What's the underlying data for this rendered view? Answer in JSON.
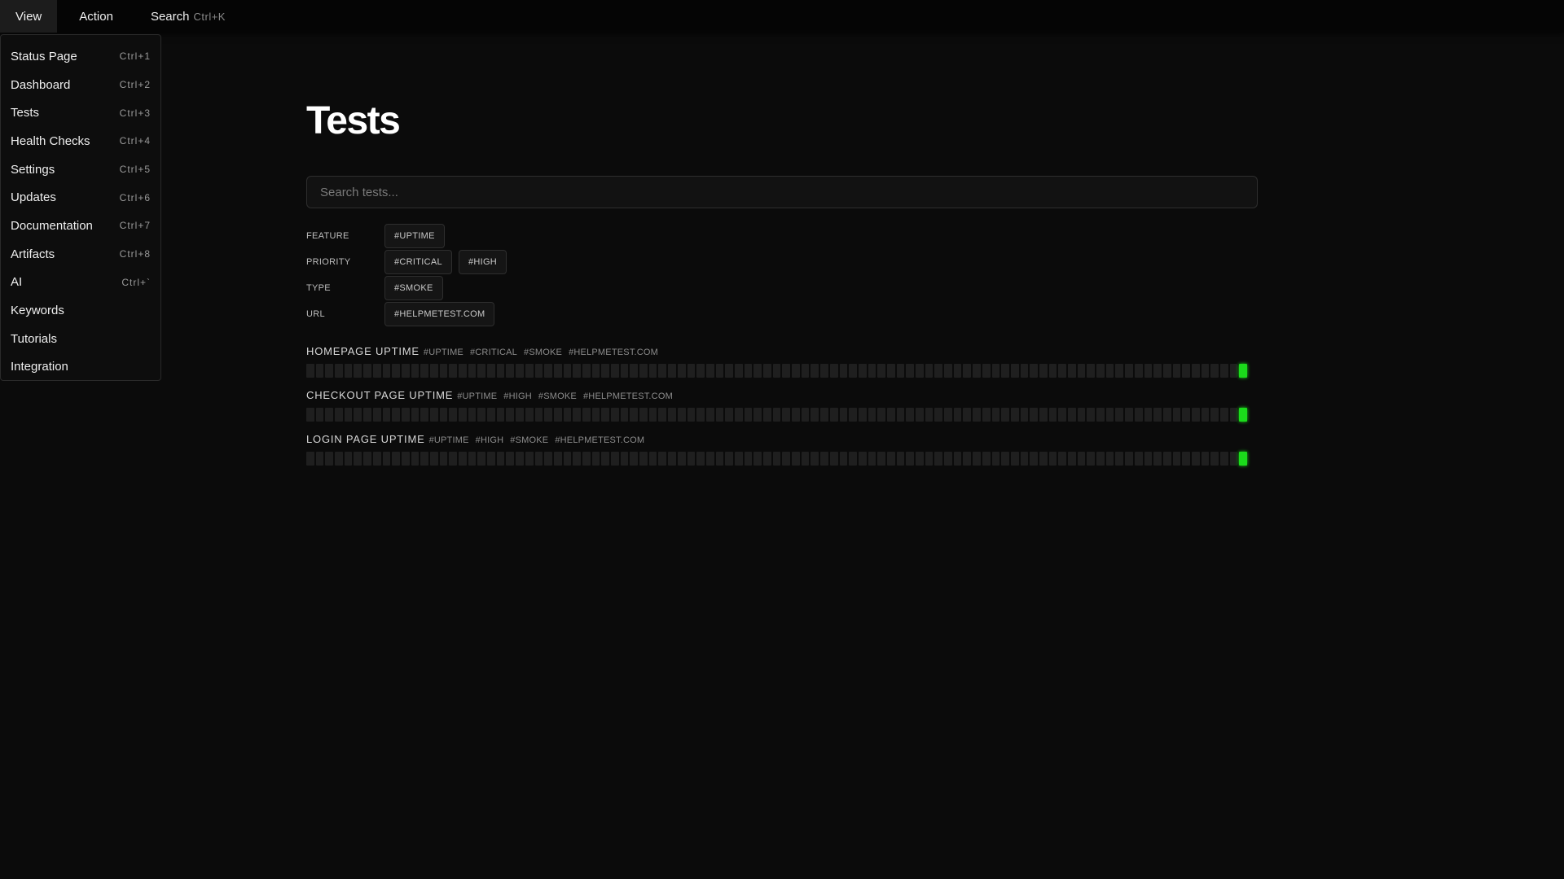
{
  "menubar": {
    "items": [
      {
        "label": "View"
      },
      {
        "label": "Action"
      },
      {
        "label": "Search",
        "shortcut": "Ctrl+K"
      }
    ]
  },
  "view_menu": {
    "items": [
      {
        "label": "Status Page",
        "shortcut": "Ctrl+1"
      },
      {
        "label": "Dashboard",
        "shortcut": "Ctrl+2"
      },
      {
        "label": "Tests",
        "shortcut": "Ctrl+3"
      },
      {
        "label": "Health Checks",
        "shortcut": "Ctrl+4"
      },
      {
        "label": "Settings",
        "shortcut": "Ctrl+5"
      },
      {
        "label": "Updates",
        "shortcut": "Ctrl+6"
      },
      {
        "label": "Documentation",
        "shortcut": "Ctrl+7"
      },
      {
        "label": "Artifacts",
        "shortcut": "Ctrl+8"
      },
      {
        "label": "AI",
        "shortcut": "Ctrl+`"
      },
      {
        "label": "Keywords",
        "shortcut": ""
      },
      {
        "label": "Tutorials",
        "shortcut": ""
      },
      {
        "label": "Integration",
        "shortcut": ""
      }
    ]
  },
  "page": {
    "title": "Tests",
    "search_placeholder": "Search tests..."
  },
  "filters": [
    {
      "label": "FEATURE",
      "chips": [
        "#UPTIME"
      ]
    },
    {
      "label": "PRIORITY",
      "chips": [
        "#CRITICAL",
        "#HIGH"
      ]
    },
    {
      "label": "TYPE",
      "chips": [
        "#SMOKE"
      ]
    },
    {
      "label": "URL",
      "chips": [
        "#HELPMETEST.COM"
      ]
    }
  ],
  "tests": [
    {
      "name": "HOMEPAGE UPTIME",
      "tags": [
        "#UPTIME",
        "#CRITICAL",
        "#SMOKE",
        "#HELPMETEST.COM"
      ],
      "history_total": 99,
      "history_passed_last": 1
    },
    {
      "name": "CHECKOUT PAGE UPTIME",
      "tags": [
        "#UPTIME",
        "#HIGH",
        "#SMOKE",
        "#HELPMETEST.COM"
      ],
      "history_total": 99,
      "history_passed_last": 1
    },
    {
      "name": "LOGIN PAGE UPTIME",
      "tags": [
        "#UPTIME",
        "#HIGH",
        "#SMOKE",
        "#HELPMETEST.COM"
      ],
      "history_total": 99,
      "history_passed_last": 1
    }
  ],
  "colors": {
    "background": "#0b0b0b",
    "pass": "#1bdb1b",
    "empty_bar": "#1f1f1f"
  },
  "icons": []
}
